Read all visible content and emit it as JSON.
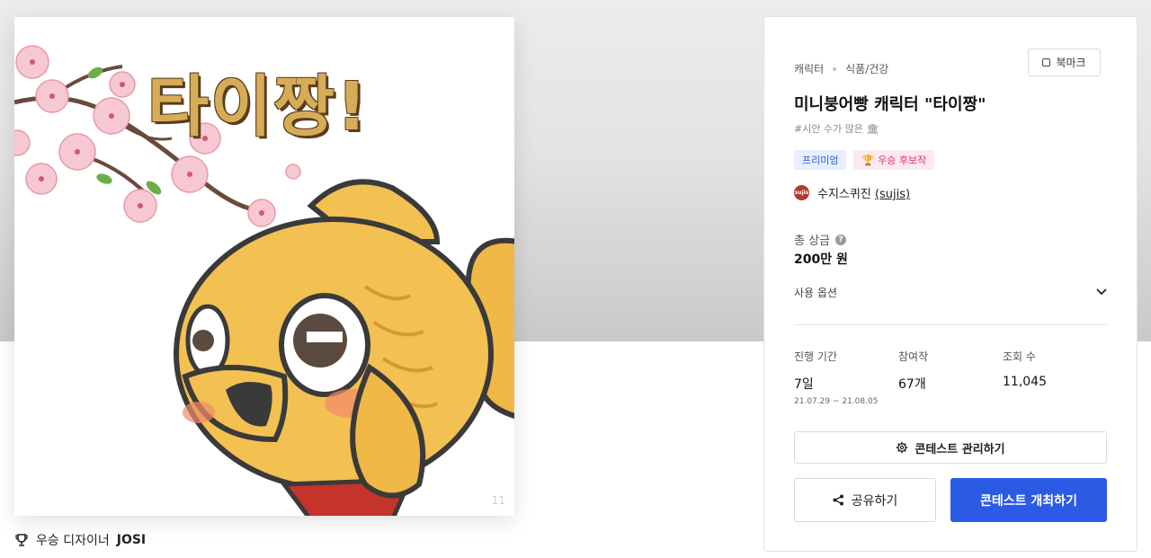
{
  "artwork": {
    "title_text": "타이짱!",
    "watermark": "11"
  },
  "winner": {
    "label": "우승 디자이너",
    "name": "JOSI"
  },
  "panel": {
    "breadcrumb": [
      "캐릭터",
      "식품/건강"
    ],
    "bookmark_label": "북마크",
    "title": "미니붕어빵 캐릭터 \"타이짱\"",
    "tag": "#시안 수가 많은 🏛",
    "badges": {
      "premium": "프리미엄",
      "award": "우승 후보작",
      "award_icon": "🏆"
    },
    "designer": {
      "avatar_text": "sujis",
      "name": "수지스퀴진",
      "handle": "(sujis)"
    },
    "prize": {
      "label": "총 상금",
      "help": "?",
      "value": "200만 원"
    },
    "usage_label": "사용 옵션",
    "stats": {
      "period": {
        "label": "진행 기간",
        "value": "7일",
        "range": "21.07.29 ~ 21.08.05"
      },
      "entries": {
        "label": "참여작",
        "value": "67개"
      },
      "views": {
        "label": "조회 수",
        "value": "11,045"
      }
    },
    "manage_button": "콘테스트 관리하기",
    "share_button": "공유하기",
    "open_button": "콘테스트 개최하기"
  },
  "colors": {
    "primary": "#2b5be5",
    "premium_badge_bg": "#e8f0ff",
    "award_badge_bg": "#fde9f2",
    "taiyaki": "#f3c052"
  },
  "icons": [
    "trophy-icon",
    "bookmark-icon",
    "help-icon",
    "chevron-down-icon",
    "gear-icon",
    "share-icon"
  ]
}
